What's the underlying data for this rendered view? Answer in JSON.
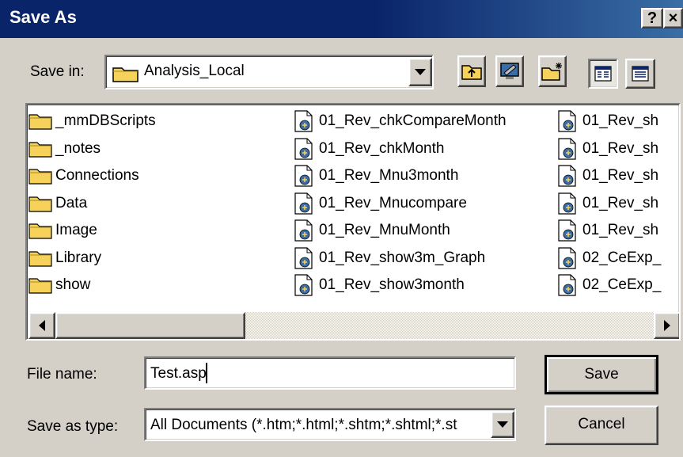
{
  "window": {
    "title": "Save As",
    "help_label": "?",
    "close_label": "×"
  },
  "save_in": {
    "label": "Save in:",
    "label_accesskey_index": 6,
    "value": "Analysis_Local"
  },
  "files": {
    "col1": [
      "_mmDBScripts",
      "_notes",
      "Connections",
      "Data",
      "Image",
      "Library",
      "show"
    ],
    "col2": [
      "01_Rev_chkCompareMonth",
      "01_Rev_chkMonth",
      "01_Rev_Mnu3month",
      "01_Rev_Mnucompare",
      "01_Rev_MnuMonth",
      "01_Rev_show3m_Graph",
      "01_Rev_show3month"
    ],
    "col3": [
      "01_Rev_sh",
      "01_Rev_sh",
      "01_Rev_sh",
      "01_Rev_sh",
      "01_Rev_sh",
      "02_CeExp_",
      "02_CeExp_"
    ]
  },
  "file_name": {
    "label": "File name:",
    "value": "Test.asp"
  },
  "save_as_type": {
    "label": "Save as type:",
    "value": "All Documents (*.htm;*.html;*.shtm;*.shtml;*.st"
  },
  "buttons": {
    "save": "Save",
    "cancel": "Cancel"
  },
  "colors": {
    "titlebar": "#0a246a",
    "face": "#d4d0c8",
    "folder": "#f7d25a"
  }
}
